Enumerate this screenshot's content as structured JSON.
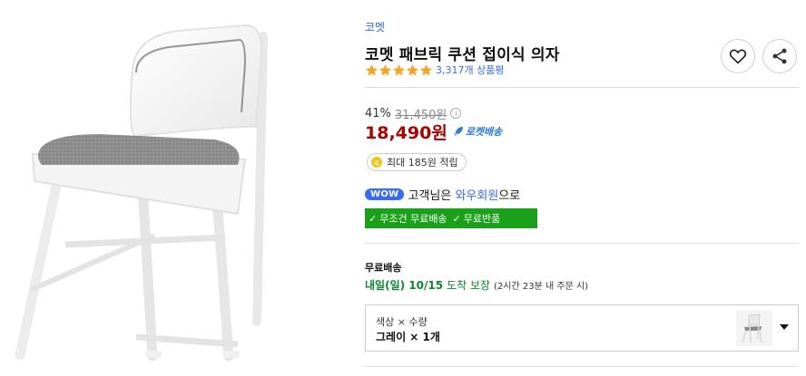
{
  "product": {
    "image_alt": "",
    "brand": "코멧",
    "title": "코멧 패브릭 쿠션 접이식 의자",
    "rating_stars": 5,
    "review_count": "3,317개 상품평"
  },
  "actions": {
    "favorite_icon": "heart-icon",
    "share_icon": "share-icon"
  },
  "price": {
    "discount_rate": "41%",
    "original_price": "31,450원",
    "info_glyph": "i",
    "sale_price": "18,490원",
    "rocket_label": "로켓배송"
  },
  "cashback": {
    "coin_glyph": "c",
    "text": "최대 185원 적립"
  },
  "wow": {
    "badge": "WOW",
    "prefix": "고객님은",
    "member": "와우회원",
    "suffix": "으로"
  },
  "benefits": [
    "무조건 무료배송",
    "무료반품"
  ],
  "delivery": {
    "label": "무료배송",
    "arrival": "내일(일) 10/15",
    "guarantee": "도착 보장",
    "cutoff": "(2시간 23분 내 주문 시)"
  },
  "option": {
    "header": "색상 × 수량",
    "value": "그레이 × 1개"
  },
  "colors": {
    "accent": "#346aff",
    "price_red": "#ae0000",
    "rocket_blue": "#2a78e4",
    "benefit_green": "#1aa11a",
    "delivery_green": "#0a8a2f",
    "star": "#f5a623"
  }
}
